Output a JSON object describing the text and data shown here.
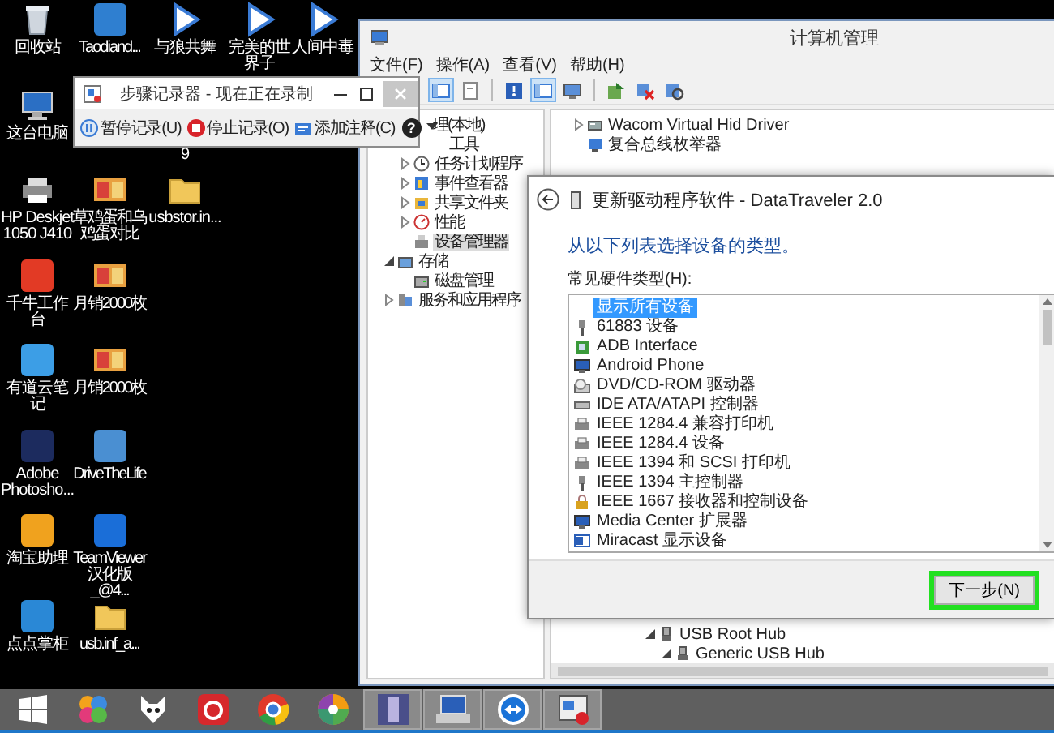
{
  "desktop": {
    "columns": [
      [
        {
          "label": "回收站",
          "kind": "recycle"
        },
        {
          "label": "这台电脑",
          "kind": "monitor"
        },
        {
          "label": "HP Deskjet 1050 J410",
          "kind": "printer"
        },
        {
          "label": "千牛工作台",
          "kind": "app",
          "color": "#e23a25"
        },
        {
          "label": "有道云笔记",
          "kind": "app",
          "color": "#3c9ee6"
        },
        {
          "label": "Adobe Photosho...",
          "kind": "app",
          "color": "#1c2b5e"
        },
        {
          "label": "淘宝助理",
          "kind": "app",
          "color": "#f0a21e"
        },
        {
          "label": "点点掌柜",
          "kind": "app",
          "color": "#2a88d6"
        }
      ],
      [
        {
          "label": "Taodiand...",
          "kind": "app",
          "color": "#2f7fd0"
        },
        null,
        {
          "label": "草鸡蛋和乌鸡蛋对比",
          "kind": "photo"
        },
        {
          "label": "月销2000枚",
          "kind": "photo"
        },
        {
          "label": "月销2000枚",
          "kind": "photo"
        },
        {
          "label": "DriveTheLife",
          "kind": "app",
          "color": "#4a8fd2"
        },
        {
          "label": "TeamViewer 汉化版_@4...",
          "kind": "app",
          "color": "#1a6ed8"
        },
        {
          "label": "usb.inf_a...",
          "kind": "folder"
        }
      ],
      [
        {
          "label": "与狼共舞",
          "kind": "video"
        },
        {
          "label": "9",
          "kind": "covered"
        },
        {
          "label": "usbstor.in...",
          "kind": "folder"
        }
      ],
      [
        {
          "label": "完美的世界子",
          "kind": "video"
        }
      ],
      [
        {
          "label": "人间中毒",
          "kind": "video"
        }
      ]
    ]
  },
  "recorder": {
    "title": "步骤记录器 - 现在正在录制",
    "help": "?",
    "buttons": [
      {
        "label": "暂停记录(U)",
        "kind": "pause"
      },
      {
        "label": "停止记录(O)",
        "kind": "stop"
      },
      {
        "label": "添加注释(C)",
        "kind": "comment"
      }
    ]
  },
  "management": {
    "title": "计算机管理",
    "menu": [
      "文件(F)",
      "操作(A)",
      "查看(V)",
      "帮助(H)"
    ],
    "toolbar": [
      {
        "kind": "panel",
        "pressed": true
      },
      {
        "kind": "sheet",
        "pressed": false
      },
      {
        "kind": "separator"
      },
      {
        "kind": "help",
        "pressed": false
      },
      {
        "kind": "panel",
        "pressed": true
      },
      {
        "kind": "monitor",
        "pressed": false
      },
      {
        "kind": "separator"
      },
      {
        "kind": "update",
        "pressed": false
      },
      {
        "kind": "remove",
        "pressed": false
      },
      {
        "kind": "scan",
        "pressed": false
      }
    ],
    "tree": [
      {
        "label": "理(本地)",
        "kind": "covered",
        "selected": false,
        "children": [
          {
            "label": "工具",
            "kind": "covered",
            "selected": false,
            "children": [
              {
                "label": "任务计划程序",
                "kind": "clock",
                "expanded": false,
                "selected": false
              },
              {
                "label": "事件查看器",
                "kind": "log",
                "expanded": false,
                "selected": false
              },
              {
                "label": "共享文件夹",
                "kind": "share",
                "expanded": false,
                "selected": false
              },
              {
                "label": "性能",
                "kind": "gauge",
                "expanded": false,
                "selected": false
              },
              {
                "label": "设备管理器",
                "kind": "device",
                "selected": true
              }
            ]
          },
          {
            "label": "存储",
            "kind": "storage",
            "expanded": true,
            "selected": false,
            "children": [
              {
                "label": "磁盘管理",
                "kind": "disk",
                "selected": false
              }
            ]
          },
          {
            "label": "服务和应用程序",
            "kind": "service",
            "expanded": false,
            "selected": false
          }
        ]
      }
    ],
    "devices_top": [
      {
        "label": "Wacom Virtual Hid Driver",
        "kind": "hid",
        "expanded": false
      },
      {
        "label": "复合总线枚举器",
        "kind": "bus"
      }
    ],
    "devices_bottom": [
      {
        "label": "USB Root Hub",
        "kind": "usb",
        "expanded": true,
        "children": [
          {
            "label": "Generic USB Hub",
            "kind": "usb",
            "expanded": true
          }
        ]
      }
    ]
  },
  "dialog": {
    "title": "更新驱动程序软件 - DataTraveler 2.0",
    "heading": "从以下列表选择设备的类型。",
    "list_label": "常见硬件类型(H):",
    "hardware_types": [
      {
        "label": "显示所有设备",
        "kind": "none",
        "selected": true
      },
      {
        "label": "61883 设备",
        "kind": "plug",
        "selected": false
      },
      {
        "label": "ADB Interface",
        "kind": "phone",
        "selected": false
      },
      {
        "label": "Android Phone",
        "kind": "monitor",
        "selected": false
      },
      {
        "label": "DVD/CD-ROM 驱动器",
        "kind": "disc",
        "selected": false
      },
      {
        "label": "IDE ATA/ATAPI 控制器",
        "kind": "drive",
        "selected": false
      },
      {
        "label": "IEEE 1284.4 兼容打印机",
        "kind": "printer",
        "selected": false
      },
      {
        "label": "IEEE 1284.4 设备",
        "kind": "printer",
        "selected": false
      },
      {
        "label": "IEEE 1394 和 SCSI 打印机",
        "kind": "printer",
        "selected": false
      },
      {
        "label": "IEEE 1394 主控制器",
        "kind": "plug",
        "selected": false
      },
      {
        "label": "IEEE 1667 接收器和控制设备",
        "kind": "lock",
        "selected": false
      },
      {
        "label": "Media Center 扩展器",
        "kind": "monitor",
        "selected": false
      },
      {
        "label": "Miracast 显示设备",
        "kind": "display",
        "selected": false
      }
    ],
    "buttons": [
      {
        "label": "下一步(N)",
        "highlighted": true
      }
    ]
  },
  "taskbar": [
    {
      "kind": "start",
      "running": false
    },
    {
      "kind": "pinwheel",
      "running": false
    },
    {
      "kind": "fox",
      "running": false
    },
    {
      "kind": "music",
      "running": false
    },
    {
      "kind": "browser",
      "running": false
    },
    {
      "kind": "ball",
      "running": false
    },
    {
      "kind": "photo",
      "running": true
    },
    {
      "kind": "computer",
      "running": true
    },
    {
      "kind": "remote",
      "running": true
    },
    {
      "kind": "recorder",
      "running": true
    }
  ]
}
